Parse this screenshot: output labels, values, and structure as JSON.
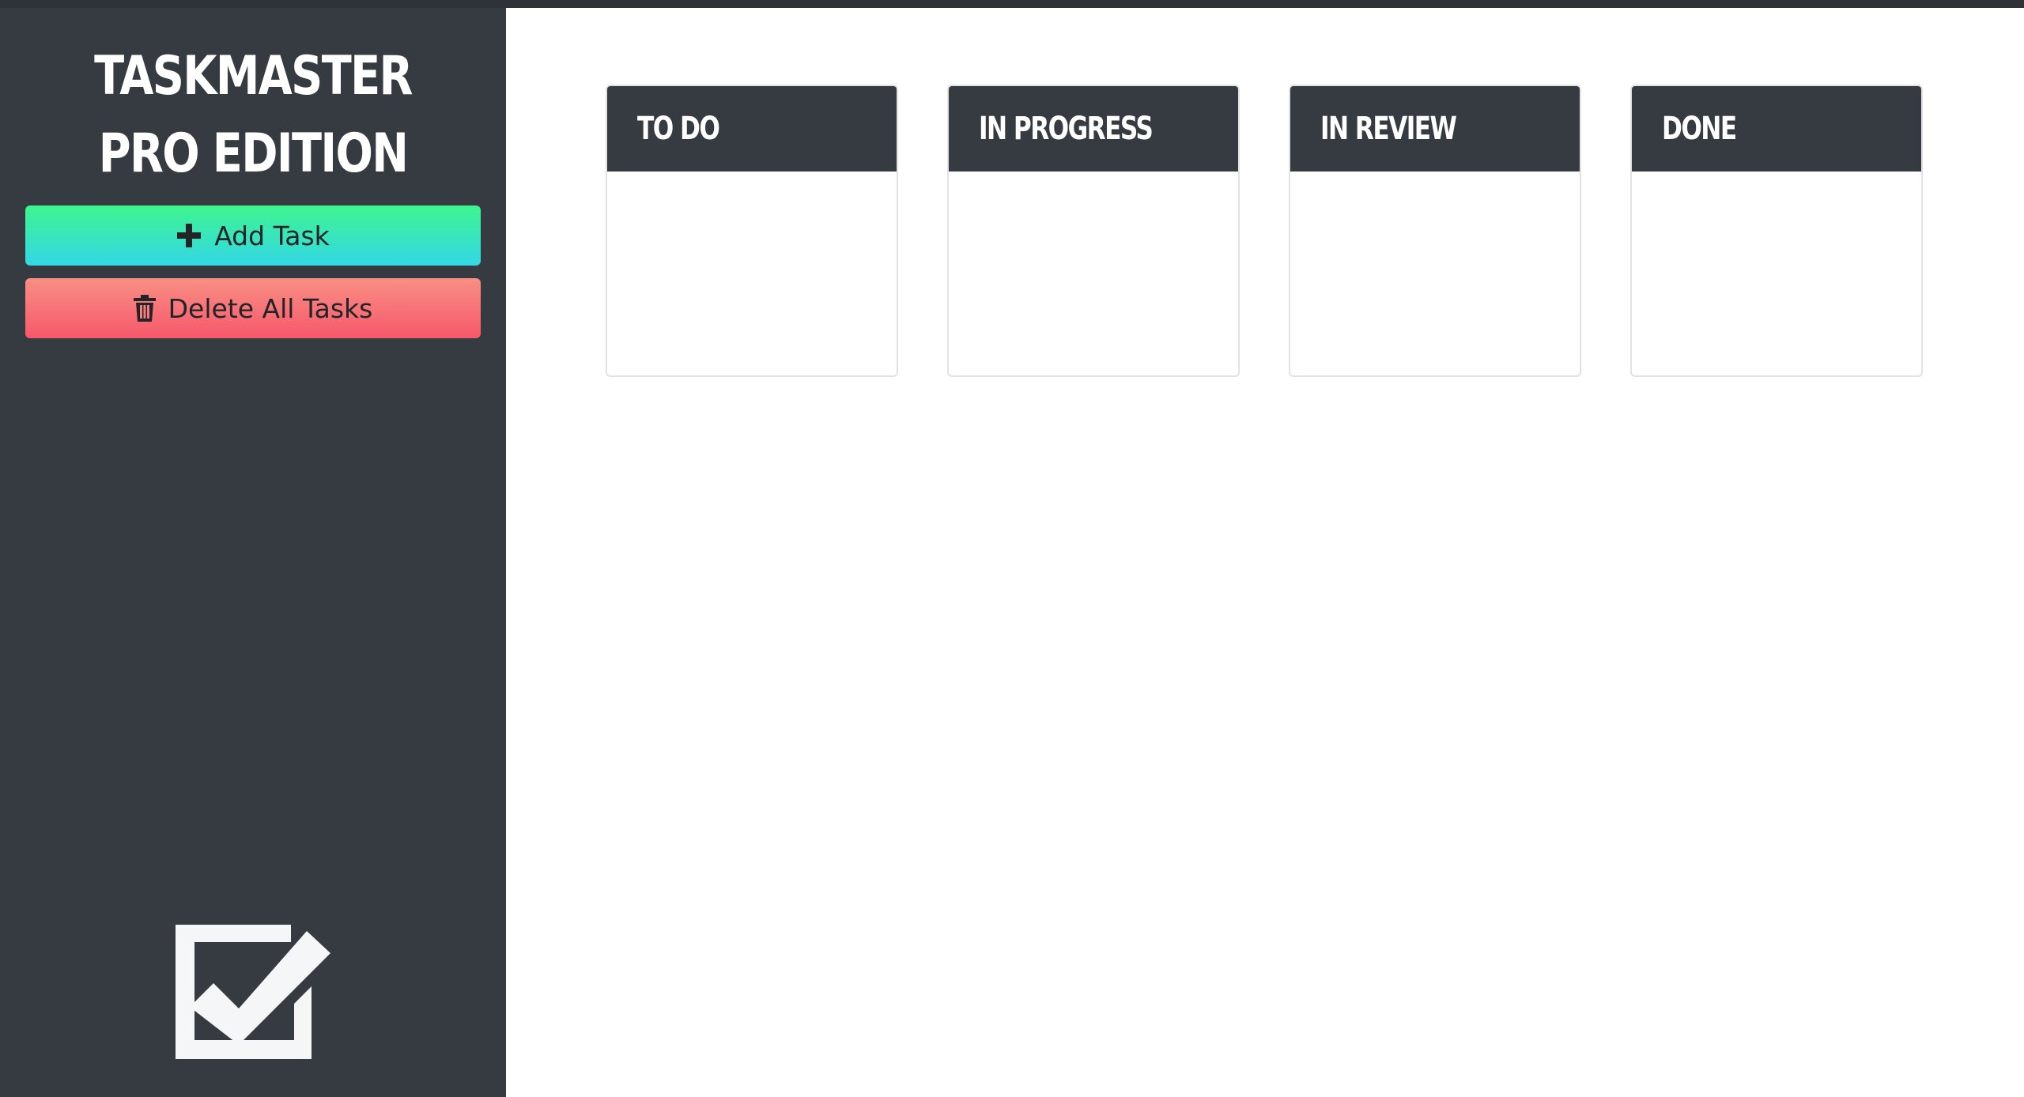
{
  "app": {
    "title": "TASKMASTER PRO EDITION"
  },
  "sidebar": {
    "add_task_label": "Add Task",
    "add_task_icon": "plus-icon",
    "delete_all_label": "Delete All Tasks",
    "delete_all_icon": "trash-icon",
    "logo_icon": "checkbox-check-icon",
    "colors": {
      "background": "#363a41",
      "add_gradient": [
        "#3ef58e",
        "#33d7e6"
      ],
      "delete_gradient": [
        "#f98f85",
        "#f6586a"
      ]
    }
  },
  "board": {
    "lanes": [
      {
        "title": "TO DO"
      },
      {
        "title": "IN PROGRESS"
      },
      {
        "title": "IN REVIEW"
      },
      {
        "title": "DONE"
      }
    ]
  }
}
